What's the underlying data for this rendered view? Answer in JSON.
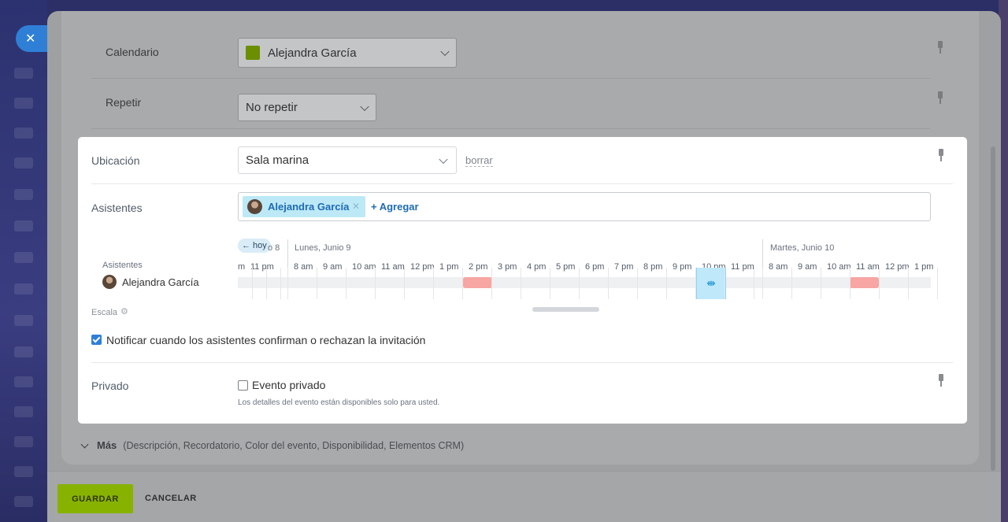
{
  "form": {
    "calendar": {
      "label": "Calendario",
      "value": "Alejandra García",
      "color": "#6b8f00"
    },
    "repeat": {
      "label": "Repetir",
      "value": "No repetir"
    },
    "location": {
      "label": "Ubicación",
      "value": "Sala marina",
      "clear_label": "borrar"
    },
    "attendees": {
      "label": "Asistentes",
      "chips": [
        {
          "name": "Alejandra García"
        }
      ],
      "add_label": "+ Agregar"
    },
    "timeline": {
      "today_label": "← hoy",
      "prev_partial": "o 8",
      "days": [
        "Lunes, Junio 9",
        "Martes, Junio 10"
      ],
      "prefix_ticks": [
        "m",
        "11 pm"
      ],
      "day1_ticks": [
        "8 am",
        "9 am",
        "10 am",
        "11 am",
        "12 pm",
        "1 pm",
        "2 pm",
        "3 pm",
        "4 pm",
        "5 pm",
        "6 pm",
        "7 pm",
        "8 pm",
        "9 pm",
        "10 pm",
        "11 pm"
      ],
      "day2_ticks": [
        "8 am",
        "9 am",
        "10 am",
        "11 am",
        "12 pm",
        "1 pm"
      ],
      "row_header": "Asistentes",
      "row_name": "Alejandra García",
      "scale_label": "Escala"
    },
    "notify": {
      "label": "Notificar cuando los asistentes confirman o rechazan la invitación",
      "checked": true
    },
    "private": {
      "label": "Privado",
      "checkbox_label": "Evento privado",
      "checked": false,
      "hint": "Los detalles del evento están disponibles solo para usted."
    },
    "more": {
      "label": "Más",
      "options": "(Descripción,  Recordatorio,  Color del evento,  Disponibilidad,  Elementos CRM)"
    }
  },
  "footer": {
    "save_label": "GUARDAR",
    "cancel_label": "CANCELAR"
  },
  "icons": {
    "close": "close-icon",
    "pin": "pin-icon",
    "gear": "gear-icon",
    "chevron": "chevron-down-icon"
  }
}
